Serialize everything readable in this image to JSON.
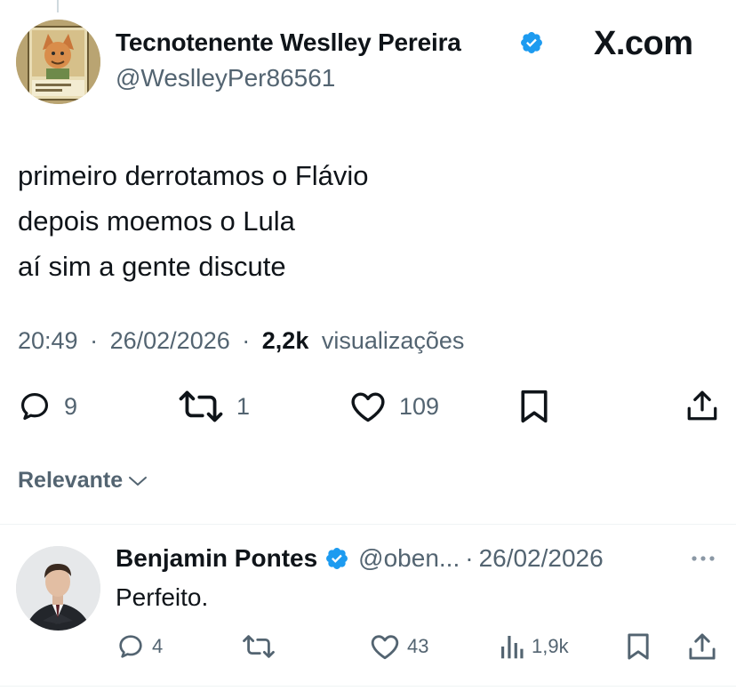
{
  "tweet": {
    "author_name": "Tecnotenente Weslley Pereira",
    "author_handle": "@WeslleyPer86561",
    "site_logo": "X.com",
    "verified_icon": "verified-badge-icon",
    "text_lines": [
      "primeiro derrotamos o Flávio",
      "depois moemos o Lula",
      "aí sim a gente discute"
    ],
    "time": "20:49",
    "date": "26/02/2026",
    "views_count": "2,2k",
    "views_label": "visualizações",
    "separator": "·",
    "actions": {
      "replies": "9",
      "reposts": "1",
      "likes": "109"
    }
  },
  "sort": {
    "label": "Relevante"
  },
  "reply": {
    "author_name": "Benjamin Pontes",
    "author_handle": "@oben...",
    "separator": "·",
    "date": "26/02/2026",
    "text": "Perfeito.",
    "actions": {
      "replies": "4",
      "likes": "43",
      "views": "1,9k"
    }
  },
  "colors": {
    "text_primary": "#0f1419",
    "text_secondary": "#536471",
    "verified_blue": "#1d9bf0",
    "divider": "#eff3f4"
  }
}
